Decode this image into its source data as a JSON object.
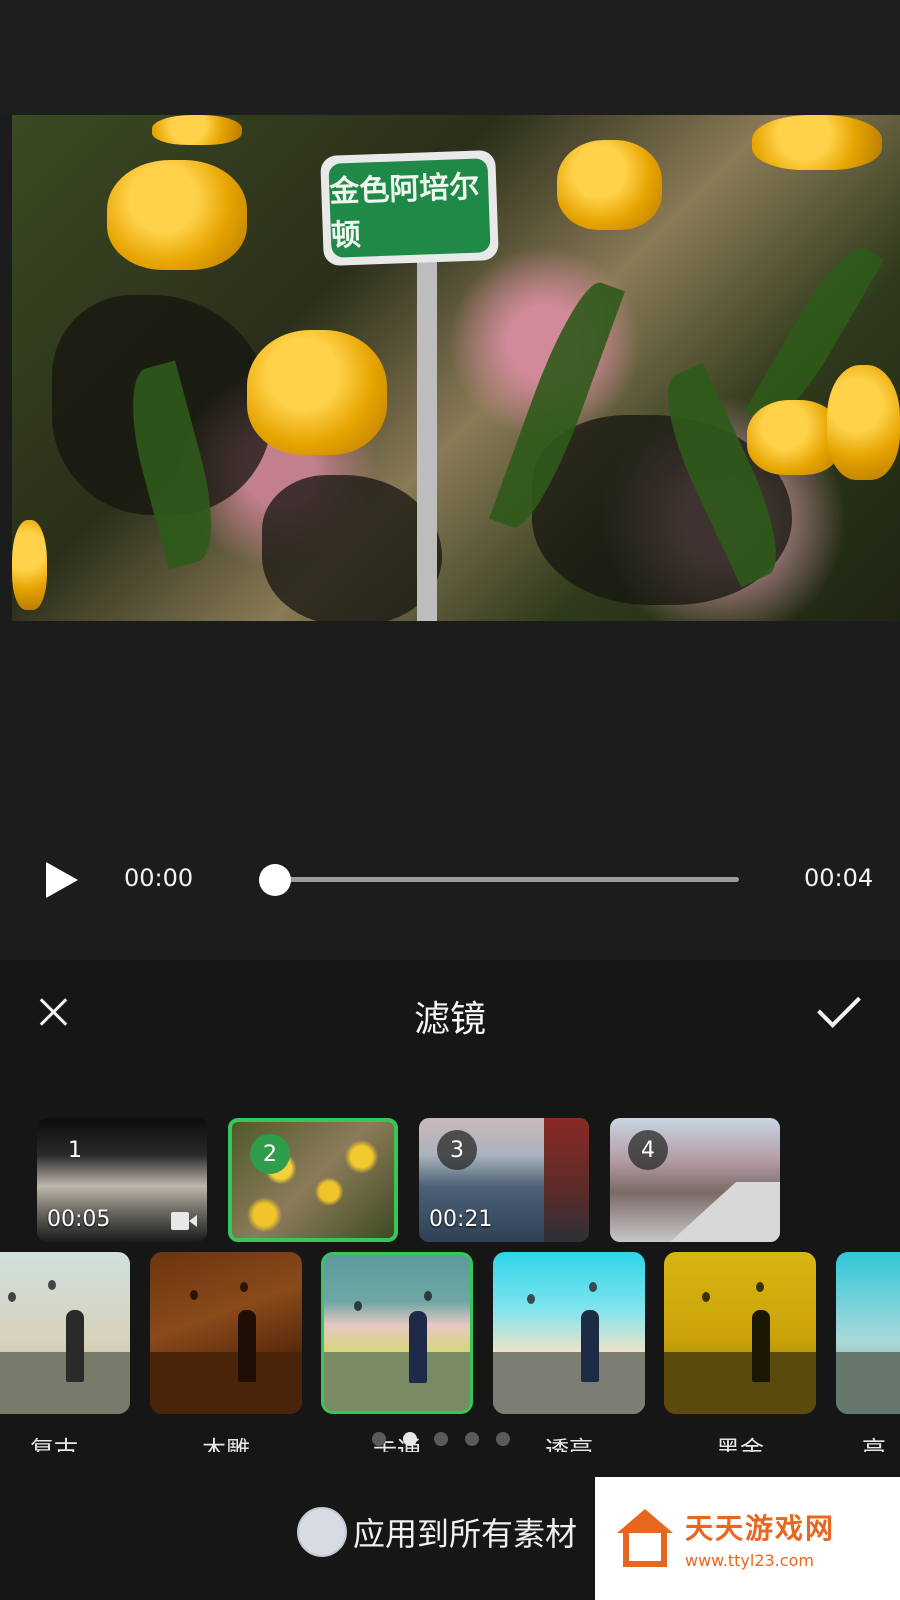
{
  "preview": {
    "sign_text": "金色阿培尔顿"
  },
  "player": {
    "current_time": "00:00",
    "total_time": "00:04",
    "progress": 0
  },
  "panel": {
    "title": "滤镜"
  },
  "clips": [
    {
      "index": "1",
      "duration": "00:05",
      "has_video_icon": true,
      "selected": false
    },
    {
      "index": "2",
      "duration": "",
      "has_video_icon": false,
      "selected": true
    },
    {
      "index": "3",
      "duration": "00:21",
      "has_video_icon": true,
      "selected": false
    },
    {
      "index": "4",
      "duration": "",
      "has_video_icon": false,
      "selected": false
    }
  ],
  "filters": [
    {
      "label": "复古",
      "selected": false
    },
    {
      "label": "木雕",
      "selected": false
    },
    {
      "label": "卡通",
      "selected": true
    },
    {
      "label": "透亮",
      "selected": false
    },
    {
      "label": "黑金",
      "selected": false
    },
    {
      "label": "高",
      "selected": false
    }
  ],
  "pagination": {
    "pages": 5,
    "active": 2
  },
  "apply_all": {
    "label": "应用到所有素材",
    "checked": false
  },
  "watermark": {
    "title": "天天游戏网",
    "url": "www.ttyl23.com"
  },
  "colors": {
    "accent": "#35c75a",
    "background": "#161616",
    "watermark_orange": "#e8671e"
  }
}
